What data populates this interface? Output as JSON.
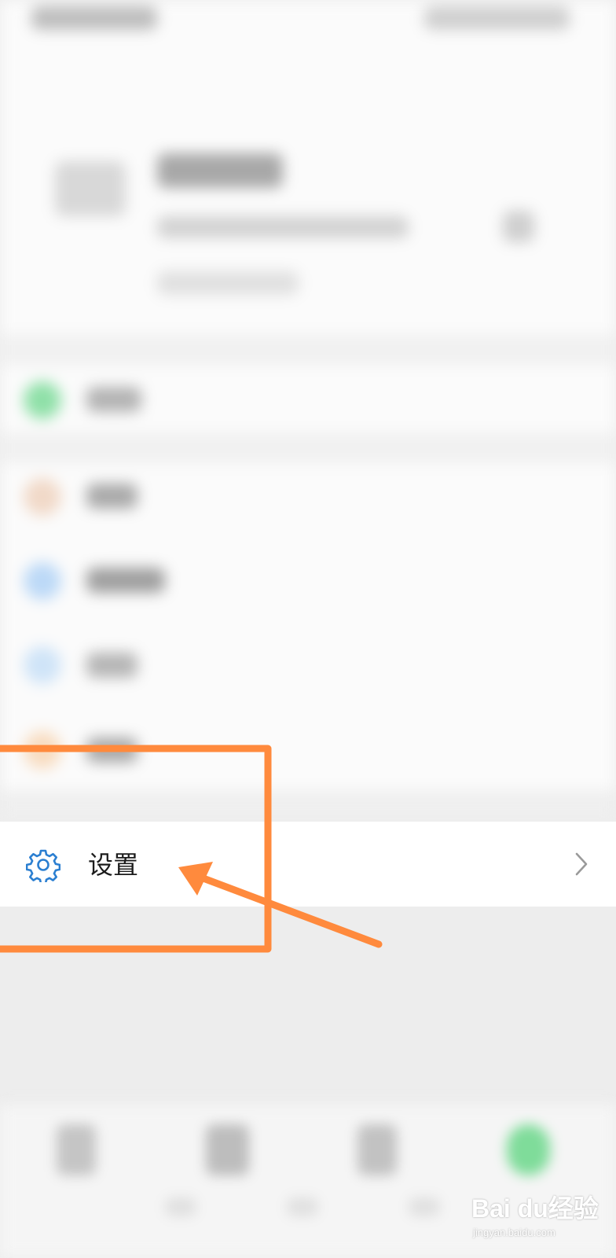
{
  "settings_row": {
    "label": "设置",
    "icon": "gear-icon",
    "chevron": "chevron-right-icon",
    "icon_color": "#2b7fd1"
  },
  "annotation": {
    "color": "#ff8a3d",
    "shapes": [
      "highlight-rectangle",
      "pointer-arrow"
    ]
  },
  "watermark": {
    "brand": "Bai du经验",
    "url": "jingyan.baidu.com"
  },
  "colors": {
    "page_background": "#ededed",
    "row_background": "#ffffff",
    "annotation": "#ff8a3d"
  }
}
